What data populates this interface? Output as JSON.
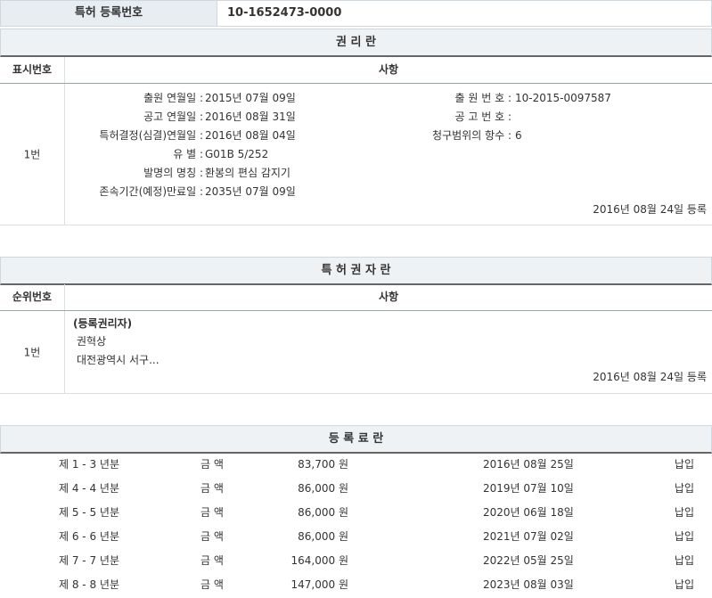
{
  "header": {
    "label": "특허 등록번호",
    "value": "10-1652473-0000"
  },
  "rights": {
    "title": "권 리 란",
    "col1": "표시번호",
    "col2": "사항",
    "row_no": "1번",
    "application_date_label": "출원 연월일 :",
    "application_date": "2015년 07월 09일",
    "application_no_label": "출 원 번 호 :",
    "application_no": "10-2015-0097587",
    "publication_date_label": "공고 연월일 :",
    "publication_date": "2016년 08월 31일",
    "publication_no_label": "공 고 번 호 :",
    "publication_no": "",
    "decision_date_label": "특허결정(심결)연월일 :",
    "decision_date": "2016년 08월 04일",
    "claims_label": "청구범위의 항수 :",
    "claims": "6",
    "class_label": "유 별 :",
    "class": "G01B 5/252",
    "invention_label": "발명의 명칭 :",
    "invention": "환봉의 편심 감지기",
    "expiry_label": "존속기간(예정)만료일 :",
    "expiry": "2035년 07월 09일",
    "registered": "2016년 08월 24일 등록"
  },
  "holder": {
    "title": "특 허 권 자 란",
    "col1": "순위번호",
    "col2": "사항",
    "row_no": "1번",
    "role": "(등록권리자)",
    "name": "권혁상",
    "address": "대전광역시 서구...",
    "registered": "2016년 08월 24일 등록"
  },
  "fees": {
    "title": "등 록 료 란",
    "rows": [
      {
        "years": "제 1 - 3 년분",
        "label": "금 액",
        "amount": "83,700 원",
        "date": "2016년 08월 25일",
        "status": "납입"
      },
      {
        "years": "제 4 - 4 년분",
        "label": "금 액",
        "amount": "86,000 원",
        "date": "2019년 07월 10일",
        "status": "납입"
      },
      {
        "years": "제 5 - 5 년분",
        "label": "금 액",
        "amount": "86,000 원",
        "date": "2020년 06월 18일",
        "status": "납입"
      },
      {
        "years": "제 6 - 6 년분",
        "label": "금 액",
        "amount": "86,000 원",
        "date": "2021년 07월 02일",
        "status": "납입"
      },
      {
        "years": "제 7 - 7 년분",
        "label": "금 액",
        "amount": "164,000 원",
        "date": "2022년 05월 25일",
        "status": "납입"
      },
      {
        "years": "제 8 - 8 년분",
        "label": "금 액",
        "amount": "147,000 원",
        "date": "2023년 08월 03일",
        "status": "납입"
      }
    ]
  }
}
